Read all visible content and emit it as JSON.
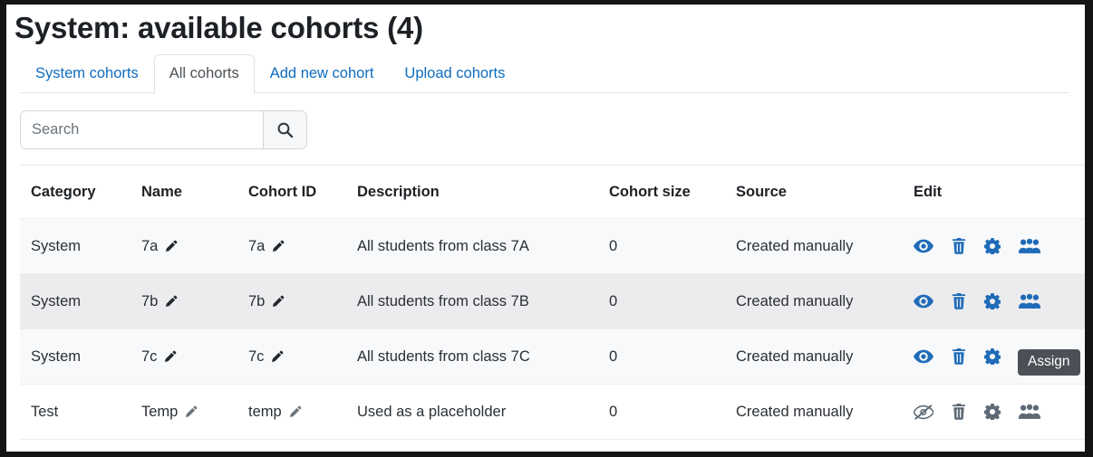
{
  "page": {
    "title": "System: available cohorts (4)"
  },
  "tabs": [
    {
      "label": "System cohorts",
      "active": false
    },
    {
      "label": "All cohorts",
      "active": true
    },
    {
      "label": "Add new cohort",
      "active": false
    },
    {
      "label": "Upload cohorts",
      "active": false
    }
  ],
  "search": {
    "value": "",
    "placeholder": "Search",
    "button_icon": "search-icon"
  },
  "table": {
    "headers": [
      "Category",
      "Name",
      "Cohort ID",
      "Description",
      "Cohort size",
      "Source",
      "Edit"
    ],
    "rows": [
      {
        "category": "System",
        "name": "7a",
        "cohort_id": "7a",
        "description": "All students from class 7A",
        "cohort_size": "0",
        "source": "Created manually",
        "dim": false,
        "shade": "a",
        "actions": [
          "eye-icon",
          "trash-icon",
          "gear-icon",
          "users-group-icon"
        ]
      },
      {
        "category": "System",
        "name": "7b",
        "cohort_id": "7b",
        "description": "All students from class 7B",
        "cohort_size": "0",
        "source": "Created manually",
        "dim": false,
        "shade": "b",
        "actions": [
          "eye-icon",
          "trash-icon",
          "gear-icon",
          "users-group-icon"
        ]
      },
      {
        "category": "System",
        "name": "7c",
        "cohort_id": "7c",
        "description": "All students from class 7C",
        "cohort_size": "0",
        "source": "Created manually",
        "dim": false,
        "shade": "a",
        "actions": [
          "eye-icon",
          "trash-icon",
          "gear-icon",
          "users-group-icon"
        ]
      },
      {
        "category": "Test",
        "name": "Temp",
        "cohort_id": "temp",
        "description": "Used as a placeholder",
        "cohort_size": "0",
        "source": "Created manually",
        "dim": true,
        "shade": "plain",
        "actions": [
          "eye-slash-icon",
          "trash-icon",
          "gear-icon",
          "users-group-icon"
        ]
      }
    ]
  },
  "tooltip": {
    "label": "Assign"
  },
  "colors": {
    "link": "#0f6cbf",
    "action_icon": "#1f6bb8",
    "action_icon_disabled": "#5d6a75",
    "text": "#1d2125",
    "muted_text": "#848b91",
    "tooltip_bg": "#4a5056"
  }
}
